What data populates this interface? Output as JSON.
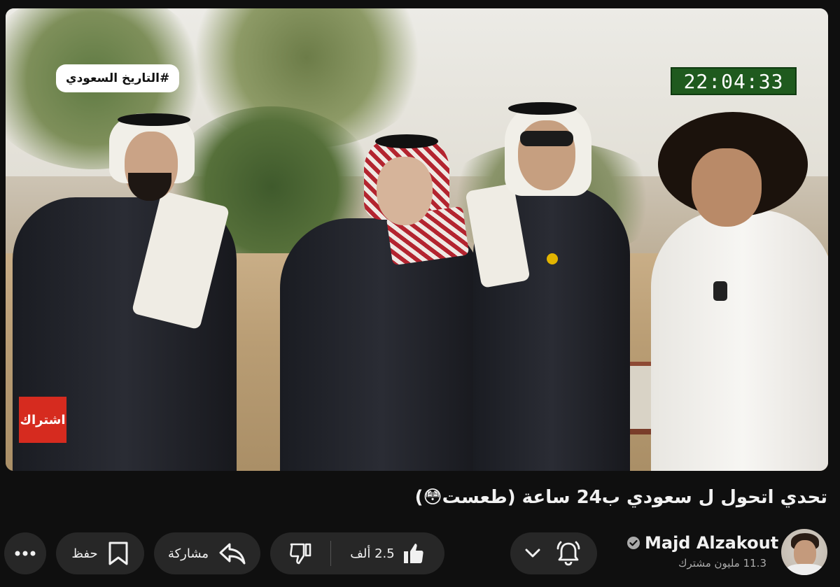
{
  "video": {
    "overlay_hashtag": "#التاريخ السعودي",
    "overlay_timer": "22:04:33",
    "overlay_subscribe": "اشتراك"
  },
  "title": "تحدي اتحول ل سعودي ب24 ساعة (طعست😳)",
  "channel": {
    "name": "Majd Alzakout",
    "subscribers": "11.3 مليون مشترك",
    "verified_icon": "check-circle-icon"
  },
  "actions": {
    "like_count": "2.5 ألف",
    "share_label": "مشاركة",
    "save_label": "حفظ"
  },
  "colors": {
    "background": "#0f0f0f",
    "button": "#272727",
    "subscribe_overlay": "#d62b1f",
    "timer_bg": "#1f5a1e"
  }
}
